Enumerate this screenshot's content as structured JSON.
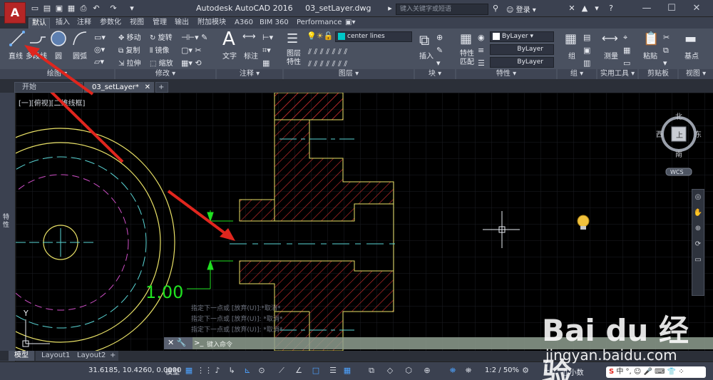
{
  "app": {
    "title": "Autodesk AutoCAD 2016",
    "filename": "03_setLayer.dwg",
    "app_letter": "A",
    "search_placeholder": "键入关键字或短语",
    "user_label": "登录"
  },
  "ribbon_tabs": [
    "默认",
    "插入",
    "注释",
    "参数化",
    "视图",
    "管理",
    "输出",
    "附加模块",
    "A360",
    "BIM 360",
    "Performance"
  ],
  "ribbon": {
    "draw": {
      "title": "绘图",
      "line": "直线",
      "polyline": "多段线",
      "circle": "圆",
      "arc": "圆弧"
    },
    "modify": {
      "title": "修改",
      "move": "移动",
      "copy": "复制",
      "stretch": "拉伸",
      "rotate": "旋转",
      "mirror": "镜像",
      "scale": "缩放"
    },
    "annotation": {
      "title": "注释",
      "text": "文字",
      "dimension": "标注"
    },
    "layers": {
      "title": "图层",
      "layer_properties": "图层\n特性",
      "current_layer": "center lines",
      "layer_color": "#00c8c8"
    },
    "block": {
      "title": "块",
      "insert": "插入"
    },
    "properties": {
      "title": "特性",
      "match": "特性\n匹配",
      "color": "ByLayer",
      "linetype": "ByLayer",
      "lineweight": "ByLayer"
    },
    "groups": {
      "title": "组",
      "group": "组"
    },
    "utilities": {
      "title": "实用工具",
      "measure": "测量"
    },
    "clipboard": {
      "title": "剪贴板",
      "paste": "粘贴"
    },
    "view": {
      "title": "视图",
      "base": "基点"
    }
  },
  "doc_tabs": [
    "开始",
    "03_setLayer*"
  ],
  "viewport_label": "[一][俯视][二维线框]",
  "left_palette_label": "特性",
  "viewcube": {
    "north": "北",
    "south": "南",
    "east": "东",
    "west": "西",
    "top": "上",
    "wcs": "WCS"
  },
  "dimension_text": "1.00",
  "command": {
    "history": [
      "指定下一点或 [放弃(U)]:*取消*",
      "指定下一点或 [放弃(U)]: *取消*",
      "指定下一点或 [放弃(U)]: *取消*"
    ],
    "placeholder": "键入命令"
  },
  "layout_tabs": [
    "模型",
    "Layout1",
    "Layout2"
  ],
  "status": {
    "coords": "31.6185, 10.4260, 0.0000",
    "model": "模型",
    "scale": "1:2 / 50%",
    "units": "小数"
  },
  "watermark": {
    "logo": "Bai du 经验",
    "url": "jingyan.baidu.com"
  }
}
